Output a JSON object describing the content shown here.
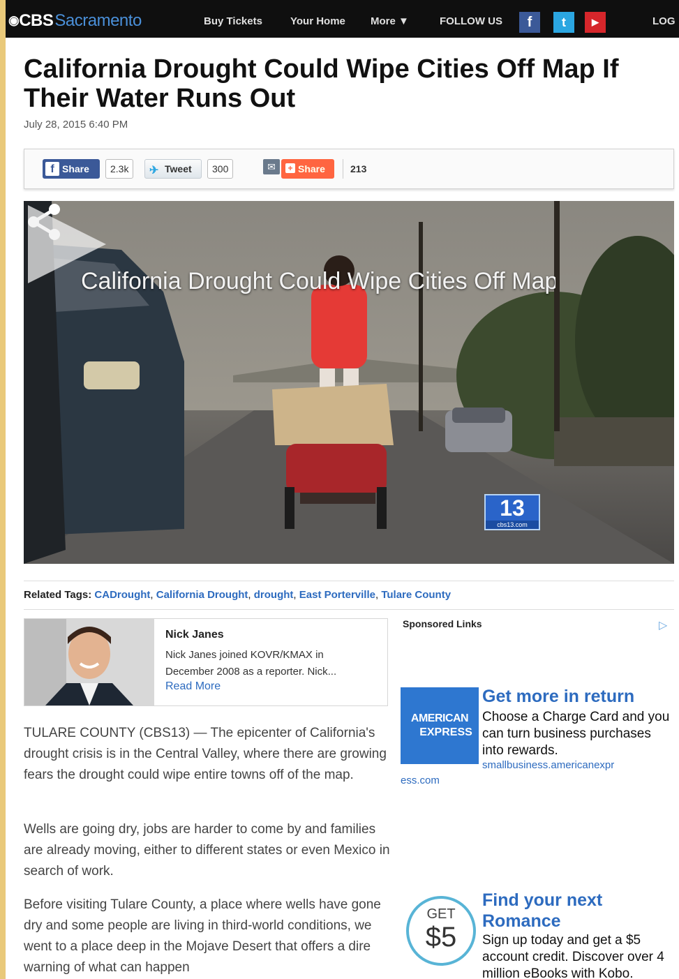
{
  "nav": {
    "logo_brand": "CBS",
    "logo_city": "Sacramento",
    "links": [
      "Buy Tickets",
      "Your Home",
      "More ▼"
    ],
    "follow_label": "FOLLOW US",
    "login_label": "LOG"
  },
  "article": {
    "headline": "California Drought Could Wipe Cities Off Map If Their Water Runs Out",
    "date": "July 28, 2015 6:40 PM",
    "share": {
      "fb_label": "Share",
      "fb_count": "2.3k",
      "tweet_label": "Tweet",
      "tweet_count": "300",
      "share_label": "Share",
      "share_count": "213"
    },
    "video": {
      "title_overlay": "California Drought Could Wipe Cities Off Map If Their Water Runs Out",
      "station_logo": "13",
      "station_domain": "cbs13.com"
    },
    "tags_label": "Related Tags:",
    "tags": [
      "CADrought",
      "California Drought",
      "drought",
      "East Porterville",
      "Tulare County"
    ],
    "author": {
      "name": "Nick Janes",
      "bio": "Nick Janes joined KOVR/KMAX in December 2008 as a reporter. Nick...",
      "read_more": "Read More"
    },
    "paragraphs": [
      "TULARE COUNTY (CBS13) — The epicenter of California's drought crisis is in the Central Valley, where there are growing fears the drought could wipe entire towns off of the map.",
      "Wells are going dry, jobs are harder to come by and families are already moving, either to different states or even Mexico in search of work.",
      "Before visiting Tulare County, a place where wells have gone dry and some people are living in third-world conditions, we went to a place deep in the Mojave Desert that offers a dire warning of what can happen"
    ]
  },
  "sponsored": {
    "label": "Sponsored Links",
    "ads": [
      {
        "title": "Get more in return",
        "text": "Choose a Charge Card and you can turn business purchases into rewards.",
        "url_line1": "smallbusiness.americanexpr",
        "url_line2": "ess.com",
        "logo_line1": "AMERICAN",
        "logo_line2": "EXPRESS"
      },
      {
        "title": "Find your next Romance",
        "text": "Sign up today and get a $5 account credit. Discover over 4 million eBooks with Kobo.",
        "badge_top": "GET",
        "badge_amount": "$5"
      }
    ]
  },
  "colors": {
    "nav_bg": "#0f0f0f",
    "link_blue": "#2d6bbf",
    "facebook": "#3b5998",
    "share_orange": "#ff6540",
    "amex_blue": "#2e77d0"
  }
}
